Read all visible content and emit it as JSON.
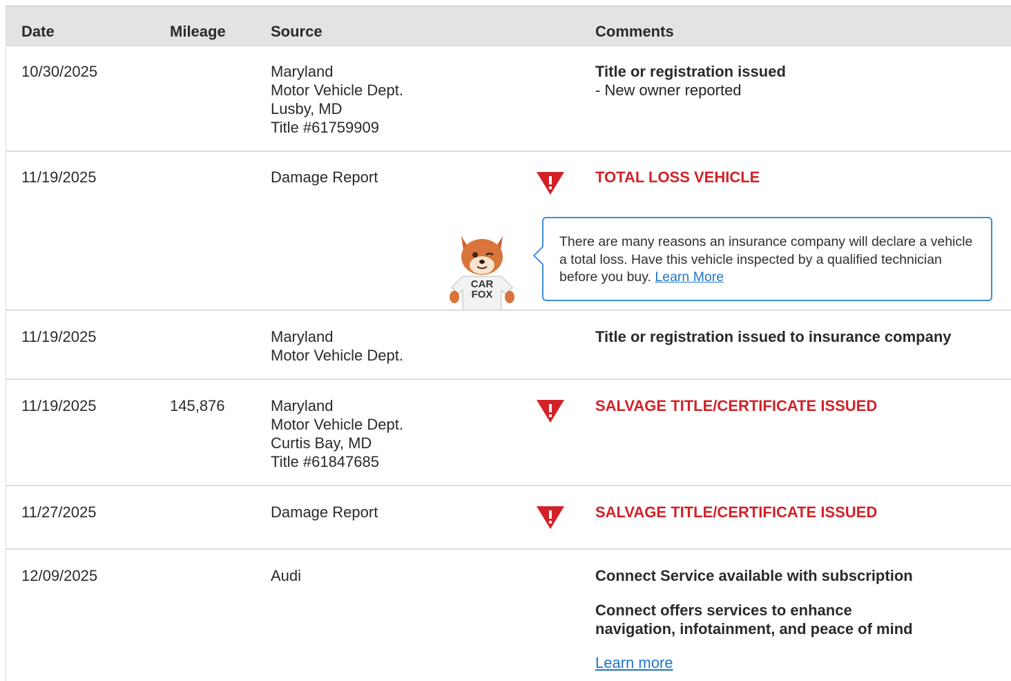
{
  "columns": {
    "date": "Date",
    "mileage": "Mileage",
    "source": "Source",
    "comments": "Comments"
  },
  "rows": [
    {
      "date": "10/30/2025",
      "mileage": "",
      "source": [
        "Maryland",
        "Motor Vehicle Dept.",
        "Lusby, MD",
        "Title #61759909"
      ],
      "comment_title": "Title or registration issued",
      "comment_detail": "- New owner reported"
    },
    {
      "date": "11/19/2025",
      "mileage": "",
      "source": [
        "Damage Report"
      ],
      "alert": "TOTAL LOSS VEHICLE",
      "icon": "warning-triangle-icon",
      "callout": {
        "text": "There are many reasons an insurance company will declare a vehicle a total loss. Have this vehicle inspected by a qualified technician before you buy.",
        "link": "Learn More"
      },
      "mascot_shirt": [
        "CAR",
        "FOX"
      ]
    },
    {
      "date": "11/19/2025",
      "mileage": "",
      "source": [
        "Maryland",
        "Motor Vehicle Dept."
      ],
      "comment_title": "Title or registration issued to insurance company"
    },
    {
      "date": "11/19/2025",
      "mileage": "145,876",
      "source": [
        "Maryland",
        "Motor Vehicle Dept.",
        "Curtis Bay, MD",
        "Title #61847685"
      ],
      "alert": "SALVAGE TITLE/CERTIFICATE ISSUED",
      "icon": "warning-triangle-icon"
    },
    {
      "date": "11/27/2025",
      "mileage": "",
      "source": [
        "Damage Report"
      ],
      "alert": "SALVAGE TITLE/CERTIFICATE ISSUED",
      "icon": "warning-triangle-icon"
    },
    {
      "date": "12/09/2025",
      "mileage": "",
      "source": [
        "Audi"
      ],
      "comment_title": "Connect Service available with subscription",
      "comment_body": "Connect offers services to enhance navigation, infotainment, and peace of mind",
      "comment_link": "Learn more"
    }
  ],
  "colors": {
    "alert": "#d32127",
    "link": "#1f75c9",
    "header_bg": "#e3e3e3"
  }
}
